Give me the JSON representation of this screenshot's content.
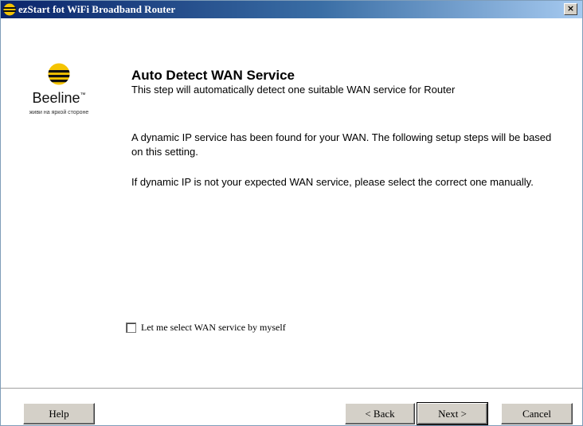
{
  "window": {
    "title": "ezStart fot WiFi Broadband Router",
    "close_label": "×"
  },
  "logo": {
    "brand": "Beeline",
    "tm": "™",
    "slogan": "живи на яркой стороне",
    "colors": {
      "yellow": "#f5c400",
      "black": "#111111"
    }
  },
  "content": {
    "heading": "Auto Detect WAN Service",
    "subheading": "This step will automatically detect one suitable WAN service for Router",
    "paragraph1": "A dynamic IP service has been found for your WAN. The following setup steps will be based on this setting.",
    "paragraph2": "If dynamic IP is not your expected WAN service, please select the correct one manually."
  },
  "checkbox": {
    "label": "Let me select WAN service by myself",
    "checked": false
  },
  "buttons": {
    "help": "Help",
    "back": "< Back",
    "next": "Next >",
    "cancel": "Cancel"
  }
}
